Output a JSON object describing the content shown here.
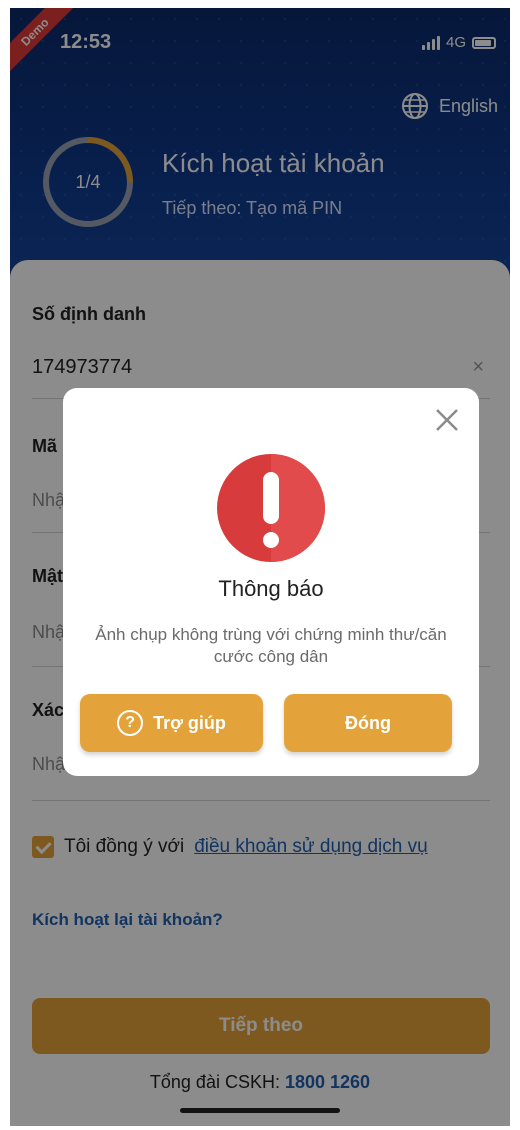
{
  "status_bar": {
    "demo_badge": "Demo",
    "time": "12:53",
    "network": "4G"
  },
  "header": {
    "language": "English",
    "step": "1/4",
    "step_progress": 0.25,
    "title": "Kích hoạt tài khoản",
    "subtitle": "Tiếp theo: Tạo mã PIN"
  },
  "form": {
    "id_label": "Số định danh",
    "id_value": "174973774",
    "pin_label": "Mã",
    "pin_placeholder": "Nhậ",
    "password_label": "Mật",
    "password_placeholder": "Nhậ",
    "confirm_label": "Xác",
    "confirm_placeholder": "Nhậ",
    "agree_text": "Tôi đồng ý với",
    "agree_link": "điều khoản sử dụng dịch vụ",
    "agree_checked": true,
    "reactivate_link": "Kích hoạt lại tài khoản?",
    "next_button": "Tiếp theo",
    "hotline_label": "Tổng đài CSKH:",
    "hotline_number": "1800 1260"
  },
  "dialog": {
    "icon": "exclamation-icon",
    "title": "Thông báo",
    "message": "Ảnh chụp không trùng với chứng minh thư/căn cước công dân",
    "help_button": "Trợ giúp",
    "close_button": "Đóng"
  },
  "colors": {
    "header_bg": "#0f3a8c",
    "accent": "#e3a33a",
    "link": "#1f5fb0",
    "alert_red": "#d83b3b"
  }
}
